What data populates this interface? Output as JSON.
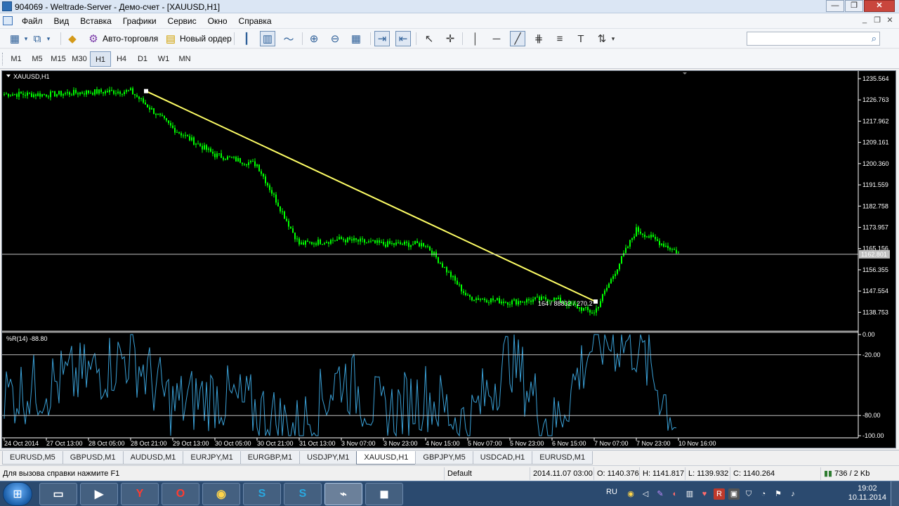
{
  "window": {
    "title": "904069 - Weltrade-Server - Демо-счет - [XAUUSD,H1]",
    "minimize_glyph": "—",
    "restore_glyph": "❐",
    "close_glyph": "✕"
  },
  "menu": {
    "items": [
      "Файл",
      "Вид",
      "Вставка",
      "Графики",
      "Сервис",
      "Окно",
      "Справка"
    ],
    "mdi_minimize": "_",
    "mdi_restore": "❐",
    "mdi_close": "✕"
  },
  "toolbar": {
    "auto_trading_label": "Авто-торговля",
    "new_order_label": "Новый ордер",
    "search_placeholder": "",
    "search_value": ""
  },
  "periods": {
    "items": [
      "M1",
      "M5",
      "M15",
      "M30",
      "H1",
      "H4",
      "D1",
      "W1",
      "MN"
    ],
    "active": "H1"
  },
  "chart": {
    "symbol_label": "XAUUSD,H1",
    "indicator_label": "%R(14) -88.80",
    "crosshair_readout": "164 / 88832 / 270.2",
    "current_price": "1162.801",
    "price_ticks": [
      "1235.564",
      "1226.763",
      "1217.962",
      "1209.161",
      "1200.360",
      "1191.559",
      "1182.758",
      "1173.957",
      "1165.156",
      "1156.355",
      "1147.554",
      "1138.753"
    ],
    "indicator_ticks": [
      "0.00",
      "-20.00",
      "-80.00",
      "-100.00"
    ],
    "time_ticks": [
      "24 Oct 2014",
      "27 Oct 13:00",
      "28 Oct 05:00",
      "28 Oct 21:00",
      "29 Oct 13:00",
      "30 Oct 05:00",
      "30 Oct 21:00",
      "31 Oct 13:00",
      "3 Nov 07:00",
      "3 Nov 23:00",
      "4 Nov 15:00",
      "5 Nov 07:00",
      "5 Nov 23:00",
      "6 Nov 15:00",
      "7 Nov 07:00",
      "7 Nov 23:00",
      "10 Nov 16:00"
    ],
    "colors": {
      "background": "#000000",
      "candles": "#00ff00",
      "trendline": "#ffff66",
      "indicator": "#3aa0d6",
      "levels": "#c0c0c0"
    }
  },
  "chart_data": {
    "type": "line",
    "ylim": [
      1131.0,
      1237.0
    ],
    "x": [
      "24 Oct 2014",
      "27 Oct 13:00",
      "28 Oct 05:00",
      "28 Oct 21:00",
      "29 Oct 13:00",
      "30 Oct 05:00",
      "30 Oct 21:00",
      "31 Oct 13:00",
      "3 Nov 07:00",
      "3 Nov 23:00",
      "4 Nov 15:00",
      "5 Nov 07:00",
      "5 Nov 23:00",
      "6 Nov 15:00",
      "7 Nov 07:00",
      "7 Nov 23:00",
      "10 Nov 16:00"
    ],
    "series": [
      {
        "name": "XAUUSD,H1",
        "values": [
          1229.2,
          1229.0,
          1230.0,
          1230.4,
          1215.0,
          1204.0,
          1200.0,
          1167.0,
          1169.0,
          1167.0,
          1167.0,
          1145.0,
          1143.0,
          1144.5,
          1138.5,
          1173.0,
          1163.5
        ]
      },
      {
        "name": "%R(14)",
        "values": [
          -60,
          -50,
          -40,
          -20,
          -70,
          -60,
          -75,
          -95,
          -40,
          -80,
          -60,
          -90,
          -20,
          -95,
          -5,
          -10,
          -88.8
        ]
      }
    ],
    "levels": [
      -20,
      -80
    ],
    "indicator_range": [
      -100,
      0
    ],
    "trendline": {
      "from": [
        "28 Oct 21:00",
        1230.4
      ],
      "to": [
        "7 Nov 07:00",
        1143.2
      ]
    }
  },
  "tabs": {
    "items": [
      "EURUSD,M5",
      "GBPUSD,M1",
      "AUDUSD,M1",
      "EURJPY,M1",
      "EURGBP,M1",
      "USDJPY,M1",
      "XAUUSD,H1",
      "GBPJPY,M5",
      "USDCAD,H1",
      "EURUSD,M1"
    ],
    "active": "XAUUSD,H1"
  },
  "status": {
    "help": "Для вызова справки нажмите F1",
    "profile": "Default",
    "datetime": "2014.11.07 03:00",
    "open": "O: 1140.376",
    "high": "H: 1141.817",
    "low": "L: 1139.932",
    "close": "C: 1140.264",
    "traffic": "736 / 2 Kb"
  },
  "taskbar": {
    "language": "RU",
    "time": "19:02",
    "date": "10.11.2014"
  }
}
